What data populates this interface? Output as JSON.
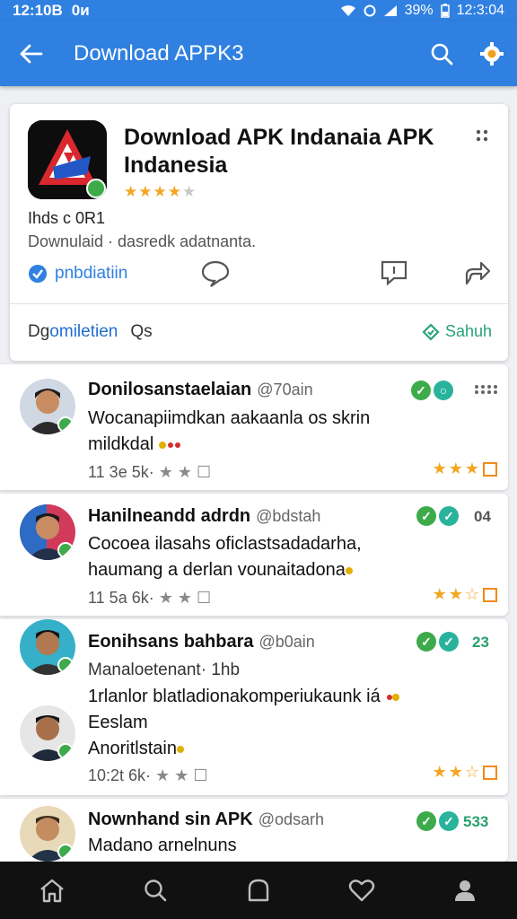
{
  "status_bar": {
    "time_left": "12:10B",
    "carrier": "0и",
    "battery": "39%",
    "time_right": "12:3:04"
  },
  "app_bar": {
    "title": "Download APPK3",
    "back_icon": "arrow-left-icon",
    "search_icon": "search-icon",
    "settings_icon": "gear-icon"
  },
  "app_card": {
    "title": "Download APK Indanaia APK Indanesia",
    "rating": 4,
    "rating_max": 5,
    "subtitle": "Ihds c 0R1",
    "description": "Downulaid · dasredk adatnanta.",
    "developer": "pnbdiatiin",
    "tab_left_a": "Dg",
    "tab_left_b": "omiletien",
    "tab_left_c": "Qs",
    "tab_right": "Sahuh"
  },
  "comments": [
    {
      "name": "Donilosanstaelaian",
      "handle": "@70ain",
      "count": "",
      "text1": "Wocanapiimdkan aakaanla os skrin",
      "text2": "mildkdal",
      "meta_a": "11 3e 5k·",
      "stars": 3,
      "stars_max": 3
    },
    {
      "name": "Hanilneandd adrdn",
      "handle": "@bdstah",
      "count": "04",
      "text1": "Cocoea ilasahs oficlastsadadarha,",
      "text2": "haumang a derlan vounaitadona",
      "meta_a": "11 5a 6k·",
      "stars": 2,
      "stars_max": 3
    },
    {
      "name": "Eonihsans bahbara",
      "handle": "@b0ain",
      "count": "23",
      "sub": "Manaloetenant· 1hb",
      "text1": "1rlanlor blatladionakomperiukaunk iá",
      "text2": "Eeslam",
      "text3": "Anoritlstain",
      "meta_a": "10:2t 6k·",
      "stars": 2,
      "stars_max": 3
    },
    {
      "name": "Nownhand sin APK",
      "handle": "@odsarh",
      "count": "533",
      "text1": "Madano arnelnuns"
    }
  ],
  "bottom_nav": [
    "home-icon",
    "search-icon",
    "bookmark-icon",
    "heart-icon",
    "profile-icon"
  ],
  "colors": {
    "primary": "#2f80e0",
    "accent_green": "#3dab4a",
    "star": "#f4a622"
  }
}
